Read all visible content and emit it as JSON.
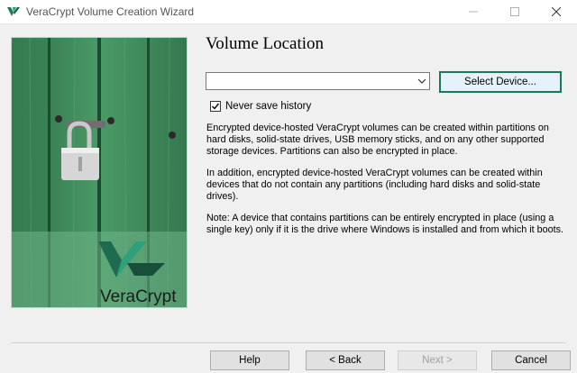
{
  "window": {
    "title": "VeraCrypt Volume Creation Wizard",
    "minimize_symbol": "—",
    "maximize_symbol": "☐",
    "close_symbol": "✕",
    "icons": [
      "veracrypt-app-icon",
      "minimize-icon",
      "maximize-icon",
      "close-icon"
    ]
  },
  "branding": {
    "logo_text": "VeraCrypt"
  },
  "page": {
    "heading": "Volume Location",
    "location_value": "",
    "select_device_label": "Select Device...",
    "never_save_history_label": "Never save history",
    "never_save_history_checked": true,
    "paragraphs": [
      "Encrypted device-hosted VeraCrypt volumes can be created within partitions on hard disks, solid-state drives, USB memory sticks, and on any other supported storage devices. Partitions can also be encrypted in place.",
      "In addition, encrypted device-hosted VeraCrypt volumes can be created within devices that do not contain any partitions (including hard disks and solid-state drives).",
      "Note: A device that contains partitions can be entirely encrypted in place (using a single key) only if it is the drive where Windows is installed and from which it boots."
    ]
  },
  "footer": {
    "help_label": "Help",
    "back_label": "< Back",
    "next_label": "Next >",
    "cancel_label": "Cancel",
    "next_enabled": false
  },
  "colors": {
    "accent": "#1a7a58",
    "wood_green": "#3e8a5c"
  }
}
